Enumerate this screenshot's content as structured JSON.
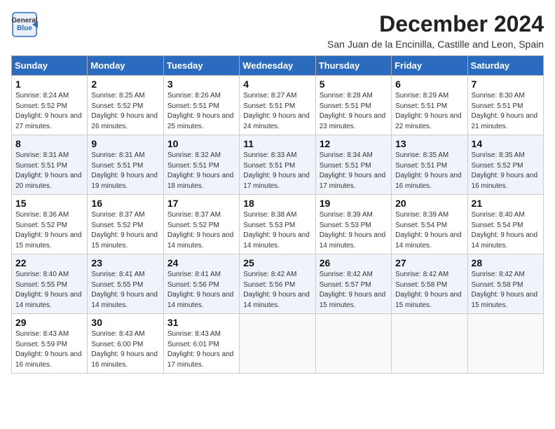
{
  "header": {
    "logo_line1": "General",
    "logo_line2": "Blue",
    "month": "December 2024",
    "location": "San Juan de la Encinilla, Castille and Leon, Spain"
  },
  "days_of_week": [
    "Sunday",
    "Monday",
    "Tuesday",
    "Wednesday",
    "Thursday",
    "Friday",
    "Saturday"
  ],
  "weeks": [
    [
      {
        "day": 1,
        "sunrise": "8:24 AM",
        "sunset": "5:52 PM",
        "daylight": "9 hours and 27 minutes."
      },
      {
        "day": 2,
        "sunrise": "8:25 AM",
        "sunset": "5:52 PM",
        "daylight": "9 hours and 26 minutes."
      },
      {
        "day": 3,
        "sunrise": "8:26 AM",
        "sunset": "5:51 PM",
        "daylight": "9 hours and 25 minutes."
      },
      {
        "day": 4,
        "sunrise": "8:27 AM",
        "sunset": "5:51 PM",
        "daylight": "9 hours and 24 minutes."
      },
      {
        "day": 5,
        "sunrise": "8:28 AM",
        "sunset": "5:51 PM",
        "daylight": "9 hours and 23 minutes."
      },
      {
        "day": 6,
        "sunrise": "8:29 AM",
        "sunset": "5:51 PM",
        "daylight": "9 hours and 22 minutes."
      },
      {
        "day": 7,
        "sunrise": "8:30 AM",
        "sunset": "5:51 PM",
        "daylight": "9 hours and 21 minutes."
      }
    ],
    [
      {
        "day": 8,
        "sunrise": "8:31 AM",
        "sunset": "5:51 PM",
        "daylight": "9 hours and 20 minutes."
      },
      {
        "day": 9,
        "sunrise": "8:31 AM",
        "sunset": "5:51 PM",
        "daylight": "9 hours and 19 minutes."
      },
      {
        "day": 10,
        "sunrise": "8:32 AM",
        "sunset": "5:51 PM",
        "daylight": "9 hours and 18 minutes."
      },
      {
        "day": 11,
        "sunrise": "8:33 AM",
        "sunset": "5:51 PM",
        "daylight": "9 hours and 17 minutes."
      },
      {
        "day": 12,
        "sunrise": "8:34 AM",
        "sunset": "5:51 PM",
        "daylight": "9 hours and 17 minutes."
      },
      {
        "day": 13,
        "sunrise": "8:35 AM",
        "sunset": "5:51 PM",
        "daylight": "9 hours and 16 minutes."
      },
      {
        "day": 14,
        "sunrise": "8:35 AM",
        "sunset": "5:52 PM",
        "daylight": "9 hours and 16 minutes."
      }
    ],
    [
      {
        "day": 15,
        "sunrise": "8:36 AM",
        "sunset": "5:52 PM",
        "daylight": "9 hours and 15 minutes."
      },
      {
        "day": 16,
        "sunrise": "8:37 AM",
        "sunset": "5:52 PM",
        "daylight": "9 hours and 15 minutes."
      },
      {
        "day": 17,
        "sunrise": "8:37 AM",
        "sunset": "5:52 PM",
        "daylight": "9 hours and 14 minutes."
      },
      {
        "day": 18,
        "sunrise": "8:38 AM",
        "sunset": "5:53 PM",
        "daylight": "9 hours and 14 minutes."
      },
      {
        "day": 19,
        "sunrise": "8:39 AM",
        "sunset": "5:53 PM",
        "daylight": "9 hours and 14 minutes."
      },
      {
        "day": 20,
        "sunrise": "8:39 AM",
        "sunset": "5:54 PM",
        "daylight": "9 hours and 14 minutes."
      },
      {
        "day": 21,
        "sunrise": "8:40 AM",
        "sunset": "5:54 PM",
        "daylight": "9 hours and 14 minutes."
      }
    ],
    [
      {
        "day": 22,
        "sunrise": "8:40 AM",
        "sunset": "5:55 PM",
        "daylight": "9 hours and 14 minutes."
      },
      {
        "day": 23,
        "sunrise": "8:41 AM",
        "sunset": "5:55 PM",
        "daylight": "9 hours and 14 minutes."
      },
      {
        "day": 24,
        "sunrise": "8:41 AM",
        "sunset": "5:56 PM",
        "daylight": "9 hours and 14 minutes."
      },
      {
        "day": 25,
        "sunrise": "8:42 AM",
        "sunset": "5:56 PM",
        "daylight": "9 hours and 14 minutes."
      },
      {
        "day": 26,
        "sunrise": "8:42 AM",
        "sunset": "5:57 PM",
        "daylight": "9 hours and 15 minutes."
      },
      {
        "day": 27,
        "sunrise": "8:42 AM",
        "sunset": "5:58 PM",
        "daylight": "9 hours and 15 minutes."
      },
      {
        "day": 28,
        "sunrise": "8:42 AM",
        "sunset": "5:58 PM",
        "daylight": "9 hours and 15 minutes."
      }
    ],
    [
      {
        "day": 29,
        "sunrise": "8:43 AM",
        "sunset": "5:59 PM",
        "daylight": "9 hours and 16 minutes."
      },
      {
        "day": 30,
        "sunrise": "8:43 AM",
        "sunset": "6:00 PM",
        "daylight": "9 hours and 16 minutes."
      },
      {
        "day": 31,
        "sunrise": "8:43 AM",
        "sunset": "6:01 PM",
        "daylight": "9 hours and 17 minutes."
      },
      null,
      null,
      null,
      null
    ]
  ]
}
